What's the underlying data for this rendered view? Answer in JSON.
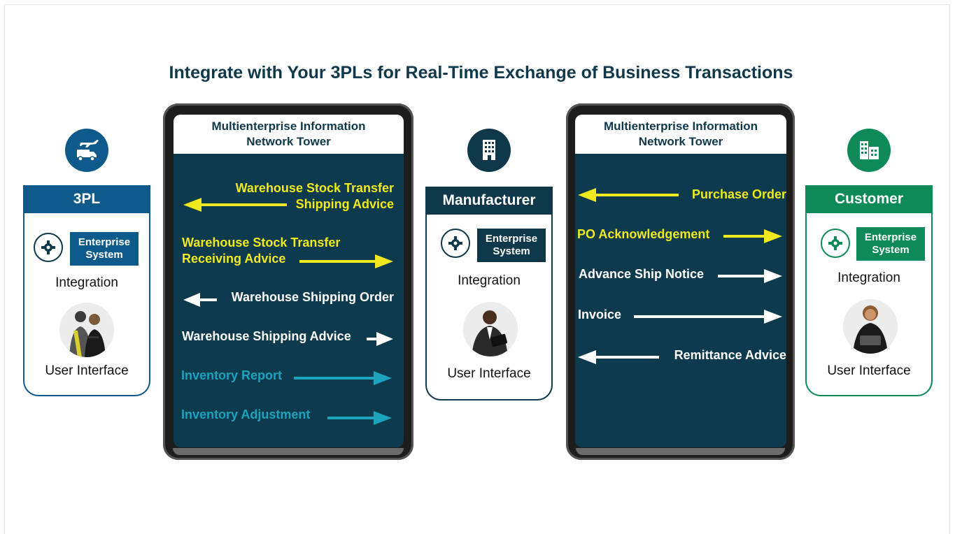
{
  "title": "Integrate with Your 3PLs for Real-Time Exchange of Business Transactions",
  "colors": {
    "navy": "#10384b",
    "blue": "#0e5a8a",
    "teal": "#0e3a4e",
    "green": "#0d8a57",
    "yellow": "#f0e91e",
    "cyan": "#1ca3be"
  },
  "entities": {
    "tpl": {
      "name": "3PL",
      "enterprise": "Enterprise System",
      "integration": "Integration",
      "ui": "User Interface",
      "icon": "truck-plane-icon"
    },
    "manufacturer": {
      "name": "Manufacturer",
      "enterprise": "Enterprise System",
      "integration": "Integration",
      "ui": "User Interface",
      "icon": "building-icon"
    },
    "customer": {
      "name": "Customer",
      "enterprise": "Enterprise System",
      "integration": "Integration",
      "ui": "User Interface",
      "icon": "office-building-icon"
    }
  },
  "tower_left": {
    "header": "Multienterprise Information Network Tower",
    "flows": [
      {
        "label": "Warehouse Stock Transfer Shipping Advice",
        "direction": "left",
        "color": "yellow"
      },
      {
        "label": "Warehouse Stock Transfer Receiving Advice",
        "direction": "right",
        "color": "yellow"
      },
      {
        "label": "Warehouse Shipping Order",
        "direction": "left",
        "color": "white"
      },
      {
        "label": "Warehouse Shipping Advice",
        "direction": "right",
        "color": "white"
      },
      {
        "label": "Inventory Report",
        "direction": "right",
        "color": "cyan"
      },
      {
        "label": "Inventory Adjustment",
        "direction": "right",
        "color": "cyan"
      }
    ]
  },
  "tower_right": {
    "header": "Multienterprise Information Network Tower",
    "flows": [
      {
        "label": "Purchase Order",
        "direction": "left",
        "color": "yellow"
      },
      {
        "label": "PO Acknowledgement",
        "direction": "right",
        "color": "yellow"
      },
      {
        "label": "Advance Ship Notice",
        "direction": "right",
        "color": "white"
      },
      {
        "label": "Invoice",
        "direction": "right",
        "color": "white"
      },
      {
        "label": "Remittance Advice",
        "direction": "left",
        "color": "white"
      }
    ]
  }
}
